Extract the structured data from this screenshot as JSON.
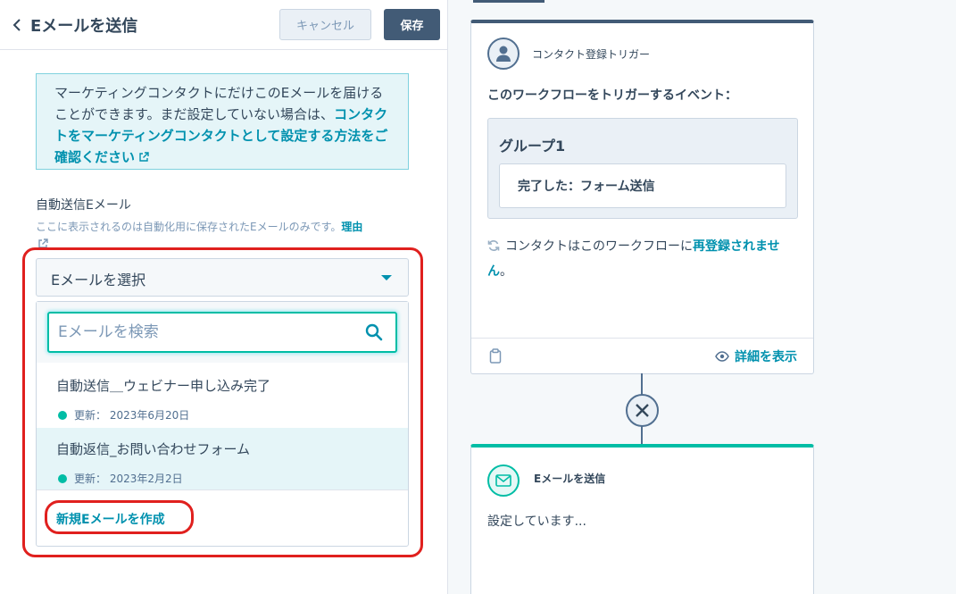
{
  "panel": {
    "title": "Eメールを送信",
    "cancel_label": "キャンセル",
    "save_label": "保存"
  },
  "info": {
    "text": "マーケティングコンタクトにだけこのEメールを届けることができます。まだ設定していない場合は、",
    "link": "コンタクトをマーケティングコンタクトとして設定する方法をご確認ください"
  },
  "field": {
    "label": "自動送信Eメール",
    "help": "ここに表示されるのは自動化用に保存されたEメールのみです。",
    "help_link": "理由"
  },
  "select": {
    "placeholder": "Eメールを選択"
  },
  "dropdown": {
    "search_placeholder": "Eメールを検索",
    "options": [
      {
        "title": "自動送信＿ウェビナー申し込み完了",
        "meta": "更新： 2023年6月20日"
      },
      {
        "title": "自動返信_お問い合わせフォーム",
        "meta": "更新： 2023年2月2日"
      }
    ],
    "create_label": "新規Eメールを作成"
  },
  "trigger_card": {
    "title": "コンタクト登録トリガー",
    "desc": "このワークフローをトリガーするイベント：",
    "group_title": "グループ1",
    "condition": "完了した：フォーム送信",
    "reenroll_text": "コンタクトはこのワークフローに",
    "reenroll_link": "再登録されません",
    "reenroll_end": "。",
    "details_label": "詳細を表示"
  },
  "action_card": {
    "title": "Eメールを送信",
    "status": "設定しています..."
  },
  "colors": {
    "accent": "#0091ae",
    "teal": "#00bda5",
    "highlight": "#e0201e",
    "dark": "#425b76"
  },
  "icons": [
    "chevron-left-icon",
    "external-link-icon",
    "caret-down-icon",
    "search-icon",
    "user-icon",
    "sync-icon",
    "clipboard-icon",
    "eye-icon",
    "close-icon",
    "mail-icon"
  ]
}
